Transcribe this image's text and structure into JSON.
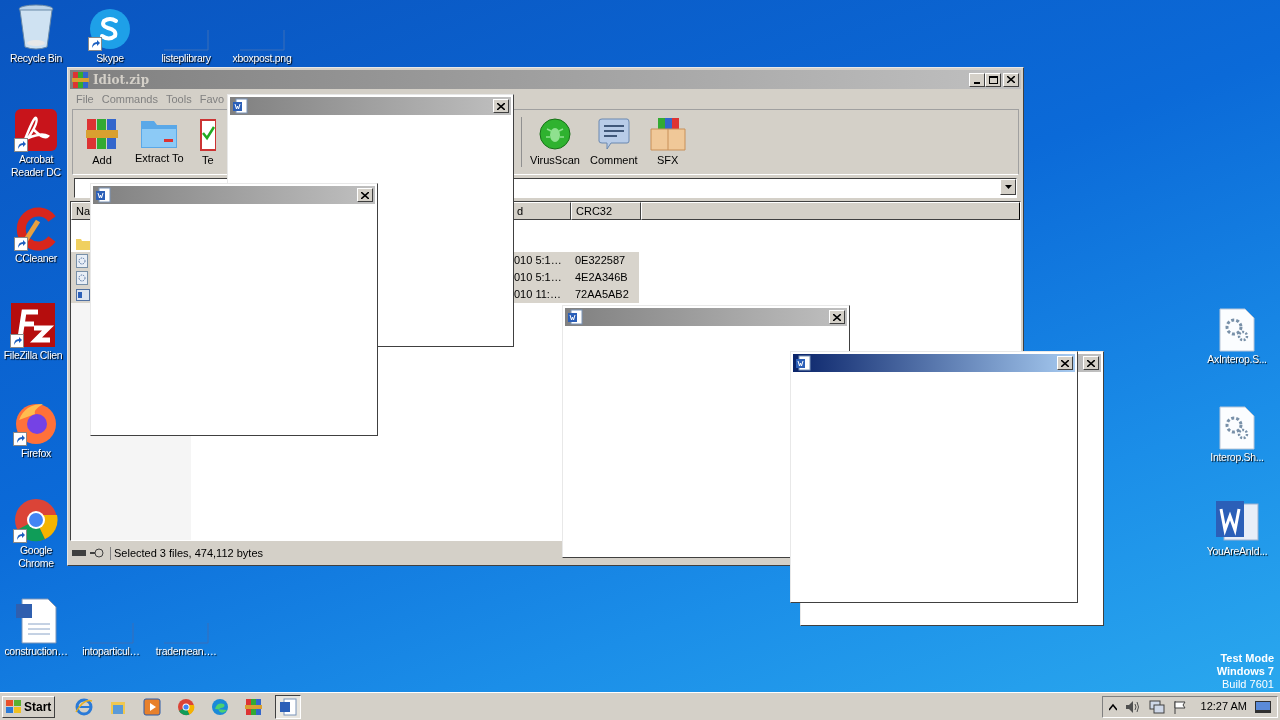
{
  "desktop_icons": [
    {
      "label": "Recycle Bin",
      "kind": "recycle",
      "shortcut": false
    },
    {
      "label": "Skype",
      "kind": "skype",
      "shortcut": true
    },
    {
      "label": "listeplibrary",
      "kind": "blank",
      "shortcut": false
    },
    {
      "label": "xboxpost.png",
      "kind": "blank",
      "shortcut": false
    },
    {
      "label": "Acrobat Reader DC",
      "kind": "acrobat",
      "shortcut": true
    },
    {
      "label": "CCleaner",
      "kind": "ccleaner",
      "shortcut": true
    },
    {
      "label": "FileZilla Clien",
      "kind": "filezilla",
      "shortcut": true
    },
    {
      "label": "Firefox",
      "kind": "firefox",
      "shortcut": true
    },
    {
      "label": "Google Chrome",
      "kind": "chrome",
      "shortcut": true
    },
    {
      "label": "construction…",
      "kind": "worddoc",
      "shortcut": false
    },
    {
      "label": "intoparticul…",
      "kind": "blank",
      "shortcut": false
    },
    {
      "label": "trademean….",
      "kind": "blank",
      "shortcut": false
    },
    {
      "label": "AxInterop.S...",
      "kind": "gears",
      "shortcut": false
    },
    {
      "label": "Interop.Sh...",
      "kind": "gears",
      "shortcut": false
    },
    {
      "label": "YouAreAnId...",
      "kind": "word",
      "shortcut": false
    }
  ],
  "archiver": {
    "title": "Idiot.zip",
    "menu": [
      "File",
      "Commands",
      "Tools",
      "Favo"
    ],
    "toolbar_left": [
      {
        "label": "Add",
        "kind": "add"
      },
      {
        "label": "Extract To",
        "kind": "extract"
      },
      {
        "label": "Te",
        "kind": "test"
      }
    ],
    "toolbar_right": [
      {
        "label": "VirusScan",
        "kind": "virus"
      },
      {
        "label": "Comment",
        "kind": "comment"
      },
      {
        "label": "SFX",
        "kind": "sfx"
      }
    ],
    "columns": [
      "Na",
      "d",
      "CRC32"
    ],
    "rows": [
      {
        "kind": "folder",
        "selected": false
      },
      {
        "kind": "file",
        "selected": true,
        "modified": "010 5:1…",
        "crc32": "0E322587"
      },
      {
        "kind": "file",
        "selected": true,
        "modified": "010 5:1…",
        "crc32": "4E2A346B"
      },
      {
        "kind": "exe",
        "selected": true,
        "modified": "010 11:…",
        "crc32": "72AA5AB2"
      }
    ],
    "status": "Selected 3 files, 474,112 bytes"
  },
  "dialogs": [
    {
      "active": false
    },
    {
      "active": false
    },
    {
      "active": false
    },
    {
      "active": false
    },
    {
      "active": true
    }
  ],
  "taskbar": {
    "start": "Start",
    "apps": [
      {
        "kind": "ie",
        "pressed": false
      },
      {
        "kind": "explorer",
        "pressed": false
      },
      {
        "kind": "media",
        "pressed": false
      },
      {
        "kind": "chrome",
        "pressed": false
      },
      {
        "kind": "edge",
        "pressed": false
      },
      {
        "kind": "winrar",
        "pressed": false
      },
      {
        "kind": "word",
        "pressed": true
      }
    ],
    "clock": "12:27 AM"
  },
  "os_notice": [
    "Test Mode",
    "Windows 7",
    "Build 7601"
  ]
}
